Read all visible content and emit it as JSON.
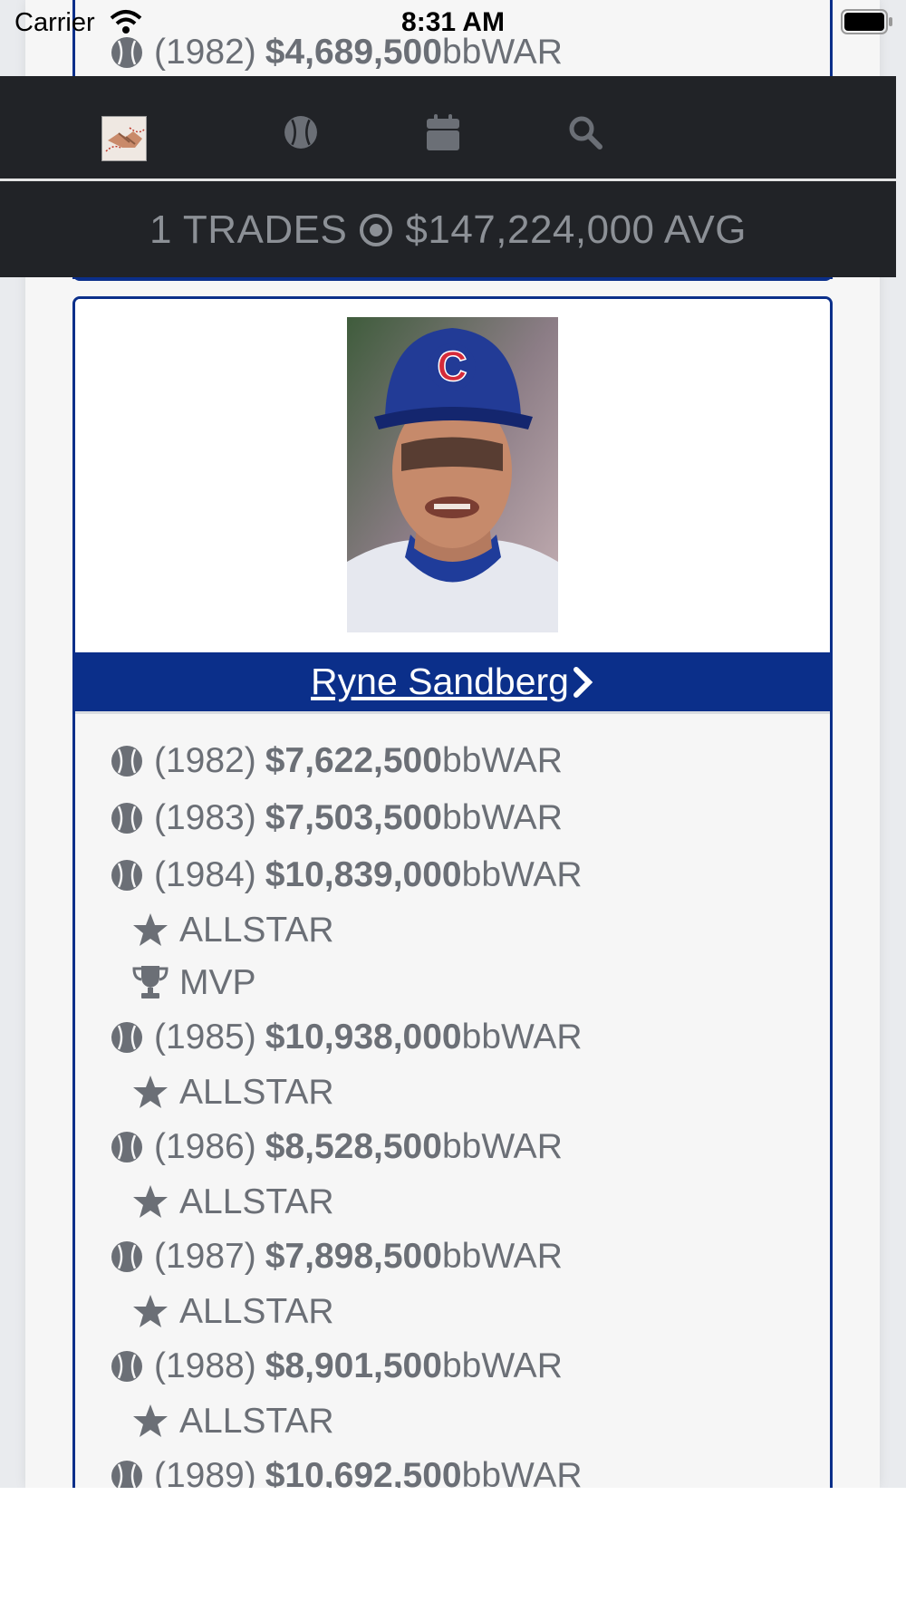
{
  "status_bar": {
    "carrier": "Carrier",
    "time": "8:31 AM"
  },
  "top_card": {
    "stats": [
      {
        "year": "(1982)",
        "amount": "$4,689,500",
        "unit": "bbWAR"
      }
    ]
  },
  "nav": {
    "items": [
      "handshake-logo",
      "baseball-icon",
      "calendar-icon",
      "search-icon"
    ]
  },
  "summary": {
    "trades": "1 TRADES",
    "avg": "$147,224,000 AVG"
  },
  "player": {
    "name": "Ryne Sandberg ",
    "stats": [
      {
        "year": "(1982)",
        "amount": "$7,622,500",
        "unit": "bbWAR"
      },
      {
        "year": "(1983)",
        "amount": "$7,503,500",
        "unit": "bbWAR"
      },
      {
        "year": "(1984)",
        "amount": "$10,839,000",
        "unit": "bbWAR",
        "awards": [
          "ALLSTAR",
          "MVP"
        ]
      },
      {
        "year": "(1985)",
        "amount": "$10,938,000",
        "unit": "bbWAR",
        "awards": [
          "ALLSTAR"
        ]
      },
      {
        "year": "(1986)",
        "amount": "$8,528,500",
        "unit": "bbWAR",
        "awards": [
          "ALLSTAR"
        ]
      },
      {
        "year": "(1987)",
        "amount": "$7,898,500",
        "unit": "bbWAR",
        "awards": [
          "ALLSTAR"
        ]
      },
      {
        "year": "(1988)",
        "amount": "$8,901,500",
        "unit": "bbWAR",
        "awards": [
          "ALLSTAR"
        ]
      },
      {
        "year": "(1989)",
        "amount": "$10,692,500",
        "unit": "bbWAR"
      }
    ]
  },
  "colors": {
    "navy": "#0b2f8a",
    "header": "#212327",
    "text_gray": "#6b6f76"
  }
}
